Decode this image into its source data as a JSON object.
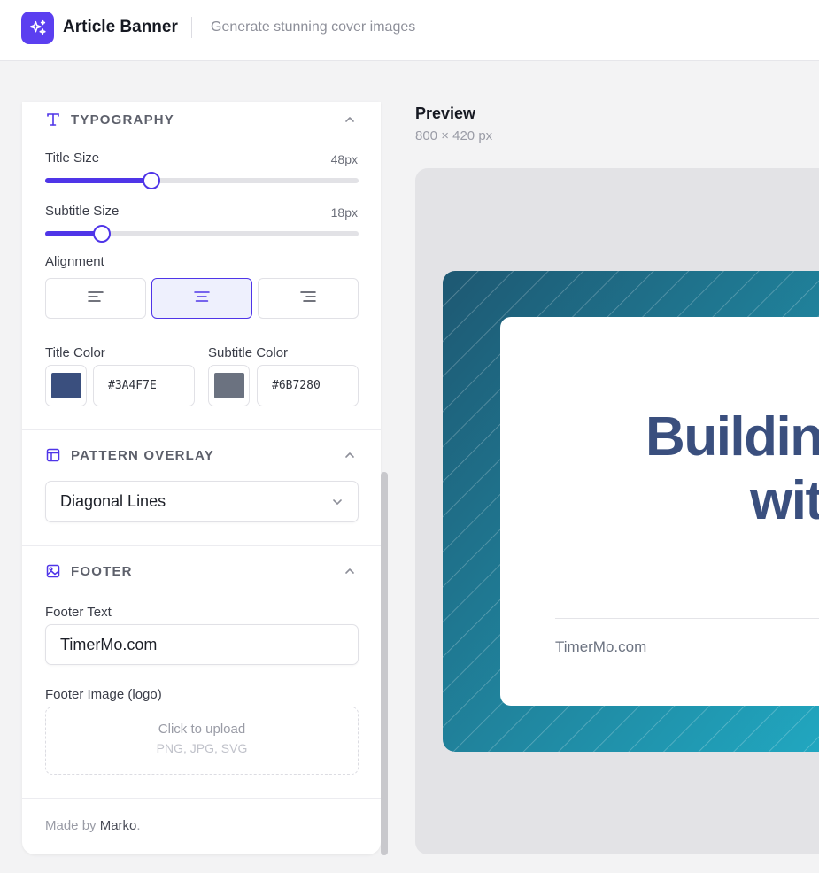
{
  "app": {
    "title": "Article Banner",
    "tagline": "Generate stunning cover images",
    "logo_icon": "sparkles-icon"
  },
  "typography": {
    "section_title": "TYPOGRAPHY",
    "title_size_label": "Title Size",
    "title_size_value": "48px",
    "title_size_fraction": 0.34,
    "subtitle_size_label": "Subtitle Size",
    "subtitle_size_value": "18px",
    "subtitle_size_fraction": 0.18,
    "alignment_label": "Alignment",
    "alignment_options": [
      "left",
      "center",
      "right"
    ],
    "alignment_selected": "center",
    "title_color_label": "Title Color",
    "title_color": "#3A4F7E",
    "subtitle_color_label": "Subtitle Color",
    "subtitle_color": "#6B7280"
  },
  "pattern": {
    "section_title": "PATTERN OVERLAY",
    "selected": "Diagonal Lines"
  },
  "footer": {
    "section_title": "FOOTER",
    "text_label": "Footer Text",
    "text_value": "TimerMo.com",
    "image_label": "Footer Image (logo)",
    "upload_text": "Click to upload",
    "upload_formats": "PNG, JPG, SVG"
  },
  "credit": {
    "prefix": "Made by ",
    "author": "Marko",
    "suffix": "."
  },
  "preview": {
    "title": "Preview",
    "size": "800 × 420 px",
    "banner_title_line1": "Building",
    "banner_title_line2": "with",
    "footer_text": "TimerMo.com"
  },
  "colors": {
    "accent": "#4F35E8",
    "gradient_start": "#1e5872",
    "gradient_end": "#21aac3"
  }
}
